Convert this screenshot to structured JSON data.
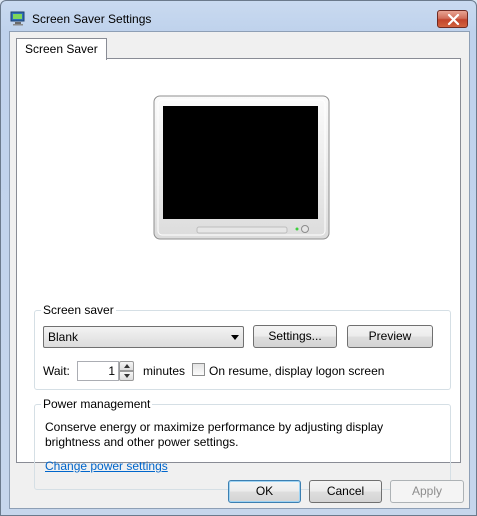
{
  "window": {
    "title": "Screen Saver Settings"
  },
  "tabs": [
    {
      "label": "Screen Saver"
    }
  ],
  "screen_saver": {
    "group_label": "Screen saver",
    "selected": "Blank",
    "settings_button": "Settings...",
    "preview_button": "Preview",
    "wait_label": "Wait:",
    "wait_value": "1",
    "minutes_label": "minutes",
    "resume_checkbox_label": "On resume, display logon screen",
    "resume_checked": false
  },
  "power": {
    "group_label": "Power management",
    "description": "Conserve energy or maximize performance by adjusting display brightness and other power settings.",
    "link": "Change power settings"
  },
  "buttons": {
    "ok": "OK",
    "cancel": "Cancel",
    "apply": "Apply"
  },
  "colors": {
    "link": "#0066cc",
    "preview_screen": "#000000",
    "close_button": "#c2442c"
  },
  "icons": {
    "title": "screen-saver-settings-icon",
    "close": "close-icon",
    "dropdown": "chevron-down-icon"
  }
}
